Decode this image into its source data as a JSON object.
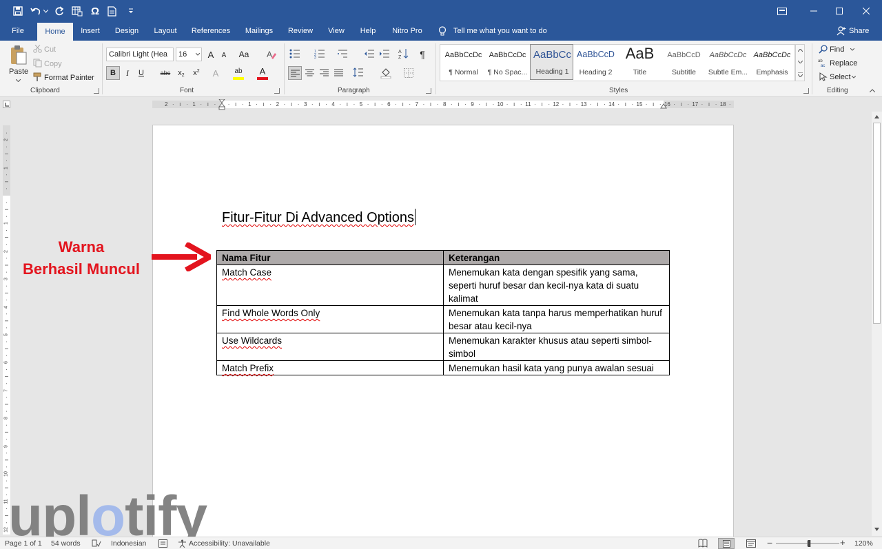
{
  "colors": {
    "accent": "#2b579a",
    "annotation": "#e3141e",
    "table_header": "#aeaaaa",
    "spell_error": "#e00000"
  },
  "quick_access": {
    "icons": [
      "save-icon",
      "undo-icon",
      "redo-icon",
      "insert-table-icon",
      "symbol-icon",
      "document-icon",
      "customize-icon"
    ],
    "symbol_glyph": "Ω"
  },
  "window_controls": [
    "ribbon-display-icon",
    "minimize-icon",
    "maximize-icon",
    "close-icon"
  ],
  "tabs": [
    "File",
    "Home",
    "Insert",
    "Design",
    "Layout",
    "References",
    "Mailings",
    "Review",
    "View",
    "Help",
    "Nitro Pro"
  ],
  "active_tab": "Home",
  "tell_me": "Tell me what you want to do",
  "share": "Share",
  "clipboard": {
    "paste": "Paste",
    "cut": "Cut",
    "copy": "Copy",
    "format_painter": "Format Painter",
    "label": "Clipboard"
  },
  "font": {
    "name": "Calibri Light (Hea",
    "size": "16",
    "grow": "A",
    "shrink": "A",
    "change_case": "Aa",
    "bold": "B",
    "italic": "I",
    "underline": "U",
    "strike": "abc",
    "subscript": "x",
    "superscript": "x",
    "sub_mark": "2",
    "sup_mark": "2",
    "effects": "A",
    "highlight": "ab",
    "color": "A",
    "label": "Font",
    "highlight_color": "#ffff00",
    "font_color": "#e3141e"
  },
  "paragraph": {
    "label": "Paragraph",
    "show_marks": "¶"
  },
  "styles": {
    "label": "Styles",
    "items": [
      {
        "preview": "AaBbCcDc",
        "name": "¶ Normal"
      },
      {
        "preview": "AaBbCcDc",
        "name": "¶ No Spac..."
      },
      {
        "preview": "AaBbCc",
        "name": "Heading 1"
      },
      {
        "preview": "AaBbCcD",
        "name": "Heading 2"
      },
      {
        "preview": "AaB",
        "name": "Title"
      },
      {
        "preview": "AaBbCcD",
        "name": "Subtitle"
      },
      {
        "preview": "AaBbCcDc",
        "name": "Subtle Em..."
      },
      {
        "preview": "AaBbCcDc",
        "name": "Emphasis"
      }
    ]
  },
  "editing": {
    "find": "Find",
    "replace": "Replace",
    "select": "Select",
    "label": "Editing"
  },
  "ruler_numbers": [
    "2",
    "1",
    "1",
    "2",
    "3",
    "4",
    "5",
    "6",
    "7",
    "8",
    "9",
    "10",
    "11",
    "12",
    "13",
    "14",
    "15",
    "16",
    "17",
    "18"
  ],
  "vruler_numbers": [
    "2",
    "1",
    "1",
    "2",
    "3",
    "4",
    "5",
    "6",
    "7",
    "8",
    "9",
    "10",
    "11",
    "12"
  ],
  "document": {
    "title": "Fitur-Fitur Di Advanced Options",
    "table": {
      "headers": [
        "Nama Fitur",
        "Keterangan"
      ],
      "rows": [
        [
          "Match Case",
          "Menemukan kata dengan spesifik yang sama, seperti huruf besar dan kecil-nya kata di suatu kalimat"
        ],
        [
          "Find Whole Words Only",
          "Menemukan kata tanpa harus memperhatikan huruf besar atau kecil-nya"
        ],
        [
          "Use Wildcards",
          "Menemukan karakter khusus atau seperti simbol-simbol"
        ],
        [
          "Match Prefix",
          "Menemukan hasil kata yang punya awalan sesuai"
        ]
      ]
    }
  },
  "annotation": {
    "line1": "Warna",
    "line2": "Berhasil Muncul"
  },
  "watermark": {
    "before": "upl",
    "accent": "o",
    "after": "tify"
  },
  "status": {
    "page": "Page 1 of 1",
    "words": "54 words",
    "language": "Indonesian",
    "accessibility": "Accessibility: Unavailable",
    "zoom": "120%",
    "zoom_level_percent": 120,
    "minus": "−",
    "plus": "+"
  }
}
